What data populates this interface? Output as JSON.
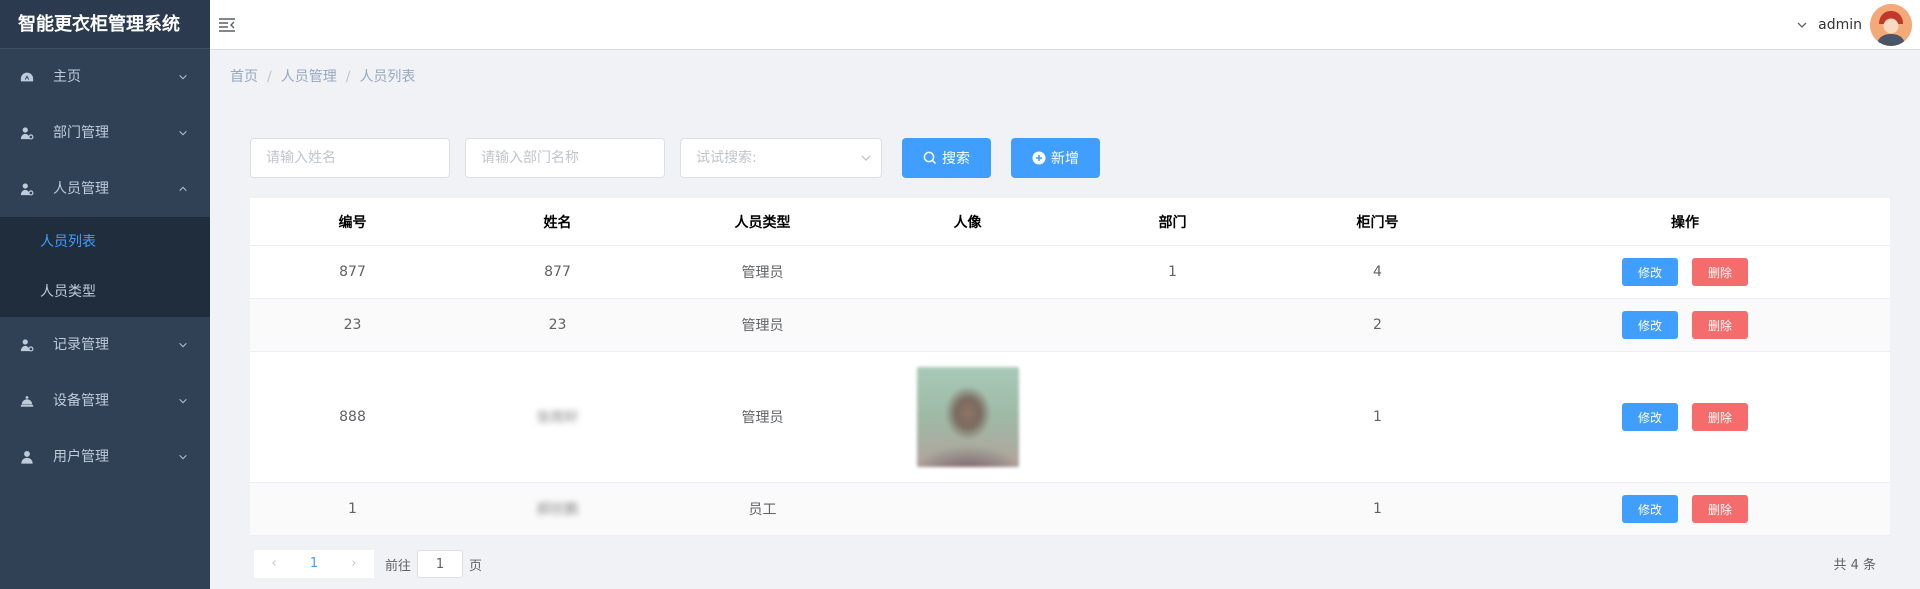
{
  "app": {
    "title": "智能更衣柜管理系统"
  },
  "sidebar": {
    "items": [
      {
        "label": "主页",
        "icon": "dashboard-icon"
      },
      {
        "label": "部门管理",
        "icon": "user-settings-icon"
      },
      {
        "label": "人员管理",
        "icon": "user-settings-icon",
        "expanded": true,
        "children": [
          {
            "label": "人员列表",
            "active": true
          },
          {
            "label": "人员类型"
          }
        ]
      },
      {
        "label": "记录管理",
        "icon": "user-settings-icon"
      },
      {
        "label": "设备管理",
        "icon": "device-icon"
      },
      {
        "label": "用户管理",
        "icon": "user-icon"
      }
    ]
  },
  "header": {
    "username": "admin"
  },
  "breadcrumb": [
    "首页",
    "人员管理",
    "人员列表"
  ],
  "filters": {
    "name_placeholder": "请输入姓名",
    "dept_placeholder": "请输入部门名称",
    "select_placeholder": "试试搜索:",
    "search_label": "搜索",
    "add_label": "新增"
  },
  "table": {
    "columns": [
      "编号",
      "姓名",
      "人员类型",
      "人像",
      "部门",
      "柜门号",
      "操作"
    ],
    "rows": [
      {
        "id": "877",
        "name": "877",
        "type": "管理员",
        "dept": "1",
        "locker": "4",
        "photo": false
      },
      {
        "id": "23",
        "name": "23",
        "type": "管理员",
        "dept": "",
        "locker": "2",
        "photo": false
      },
      {
        "id": "888",
        "name": "张雨轩",
        "type": "管理员",
        "dept": "",
        "locker": "1",
        "photo": true,
        "blurred_name": true
      },
      {
        "id": "1",
        "name": "郝欣鹏",
        "type": "员工",
        "dept": "",
        "locker": "1",
        "photo": false,
        "blurred_name": true
      }
    ],
    "edit_label": "修改",
    "delete_label": "删除"
  },
  "pagination": {
    "current": "1",
    "goto_prefix": "前往",
    "goto_value": "1",
    "goto_suffix": "页",
    "total": "共 4 条"
  },
  "colors": {
    "primary": "#409eff",
    "danger": "#f56c6c",
    "sidebar": "#304156"
  }
}
